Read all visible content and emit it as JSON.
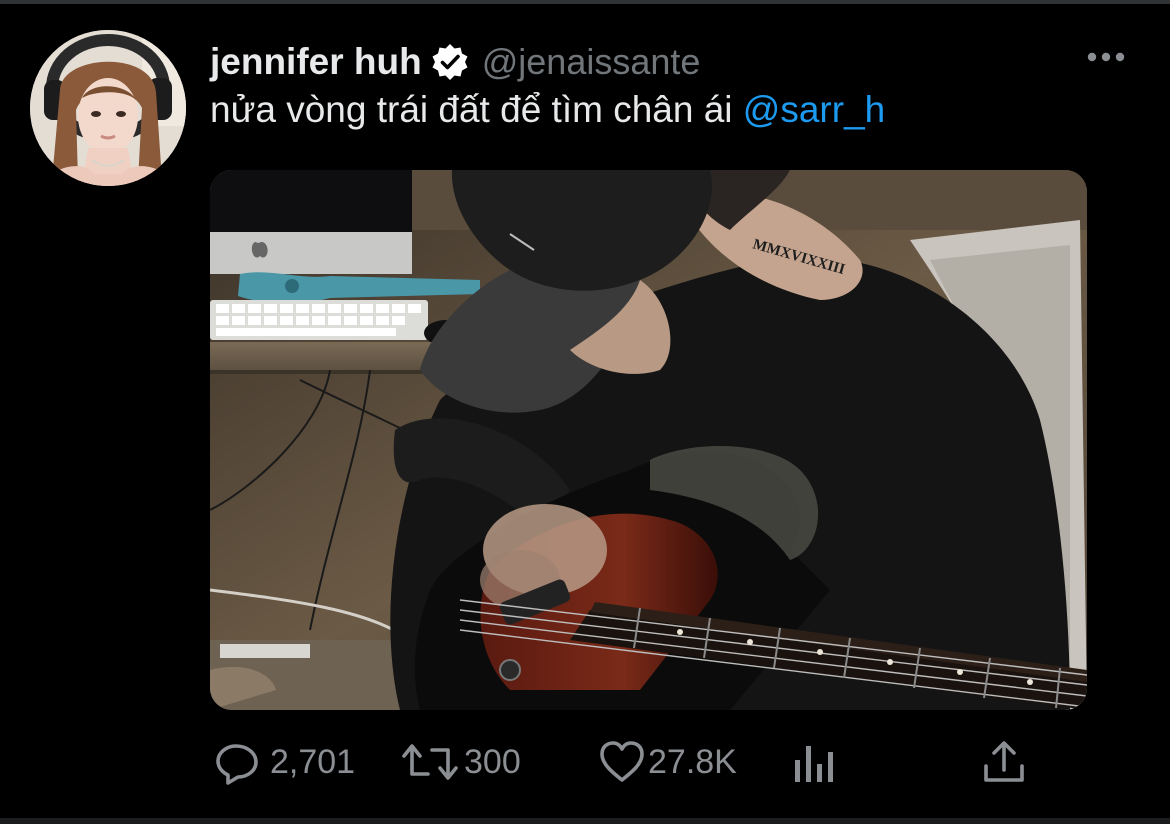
{
  "tweet": {
    "display_name": "jennifer huh",
    "verified": true,
    "handle": "@jenaissante",
    "text_main": "nửa vòng trái đất để tìm chân ái ",
    "mention": "@sarr_h",
    "media_tattoo": "MMXVIXXIII"
  },
  "actions": {
    "replies": "2,701",
    "retweets": "300",
    "likes": "27.8K"
  },
  "icons": {
    "verified": "verified-badge-icon",
    "more": "more-dots-icon",
    "reply": "reply-bubble-icon",
    "retweet": "retweet-icon",
    "like": "heart-icon",
    "analytics": "bar-chart-icon",
    "share": "share-upload-icon"
  },
  "colors": {
    "background": "#000000",
    "text": "#e7e9ea",
    "secondary": "#71767b",
    "accent": "#1d9bf0",
    "icon": "#8b8f93"
  }
}
